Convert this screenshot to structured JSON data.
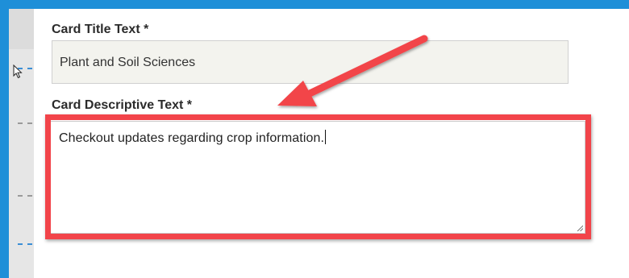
{
  "form": {
    "title_field": {
      "label": "Card Title Text *",
      "value": "Plant and Soil Sciences"
    },
    "description_field": {
      "label": "Card Descriptive Text *",
      "value": "Checkout updates regarding crop information."
    }
  },
  "annotation": {
    "highlight_color": "#f2444a",
    "arrow_color": "#f2444a"
  },
  "frame": {
    "accent_color": "#1e8fd8"
  },
  "icons": {
    "cursor": "mouse-pointer-icon",
    "resize": "resize-grip-icon"
  }
}
